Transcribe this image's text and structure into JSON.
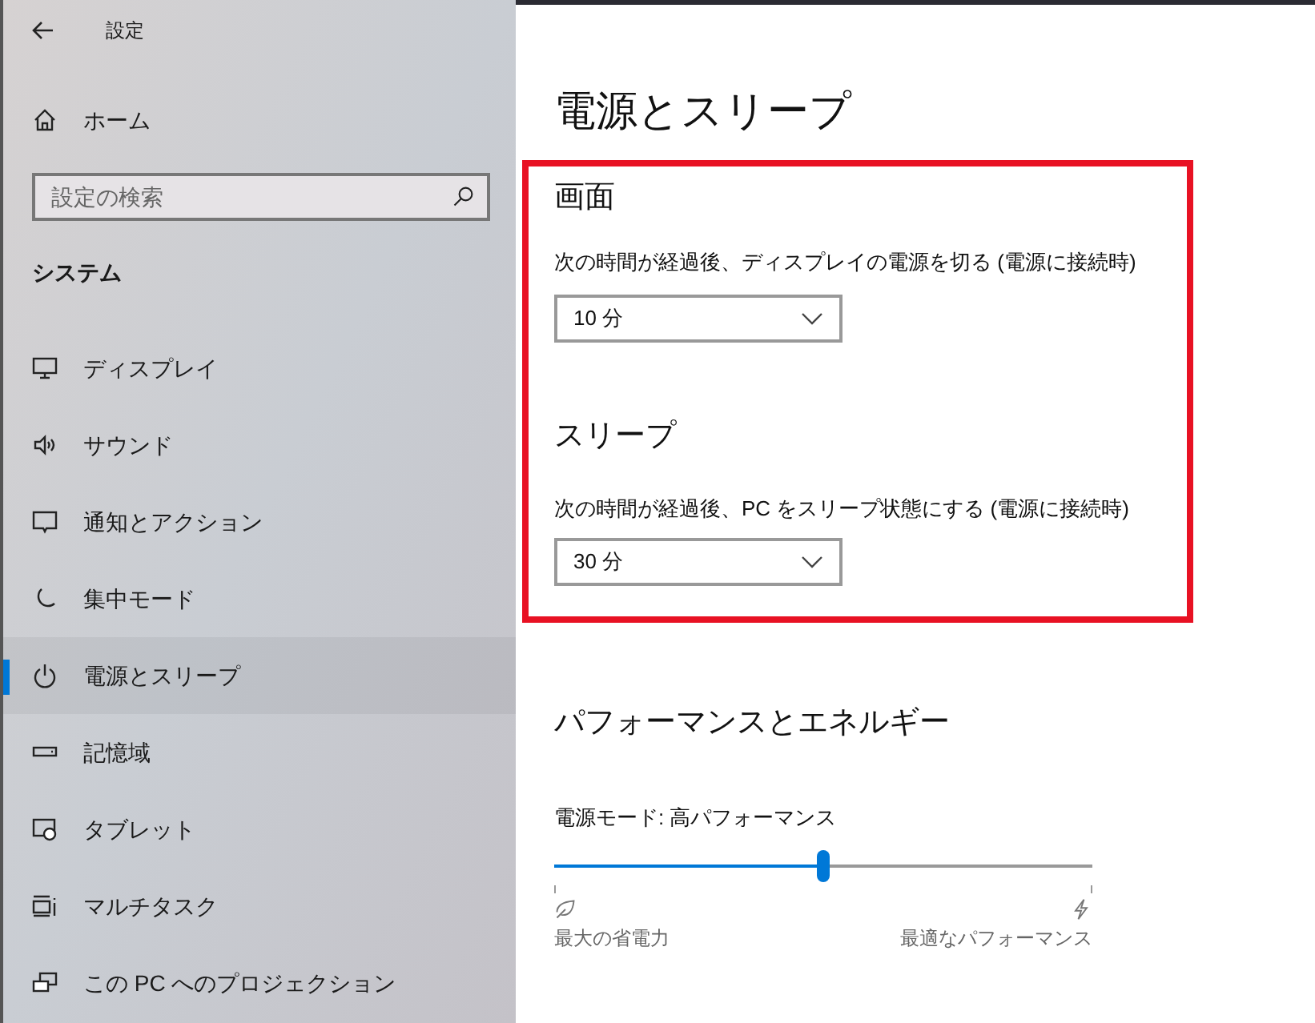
{
  "window": {
    "title": "設定"
  },
  "sidebar": {
    "home": "ホーム",
    "search": {
      "placeholder": "設定の検索"
    },
    "section": "システム",
    "items": [
      {
        "label": "ディスプレイ",
        "selected": false
      },
      {
        "label": "サウンド",
        "selected": false
      },
      {
        "label": "通知とアクション",
        "selected": false
      },
      {
        "label": "集中モード",
        "selected": false
      },
      {
        "label": "電源とスリープ",
        "selected": true
      },
      {
        "label": "記憶域",
        "selected": false
      },
      {
        "label": "タブレット",
        "selected": false
      },
      {
        "label": "マルチタスク",
        "selected": false
      },
      {
        "label": "この PC へのプロジェクション",
        "selected": false
      }
    ]
  },
  "page": {
    "title": "電源とスリープ",
    "screen": {
      "heading": "画面",
      "label": "次の時間が経過後、ディスプレイの電源を切る (電源に接続時)",
      "value": "10 分"
    },
    "sleep": {
      "heading": "スリープ",
      "label": "次の時間が経過後、PC をスリープ状態にする (電源に接続時)",
      "value": "30 分"
    },
    "performance": {
      "heading": "パフォーマンスとエネルギー",
      "mode_label": "電源モード: 高パフォーマンス",
      "level": 0.5,
      "min_label": "最大の省電力",
      "max_label": "最適なパフォーマンス"
    }
  }
}
